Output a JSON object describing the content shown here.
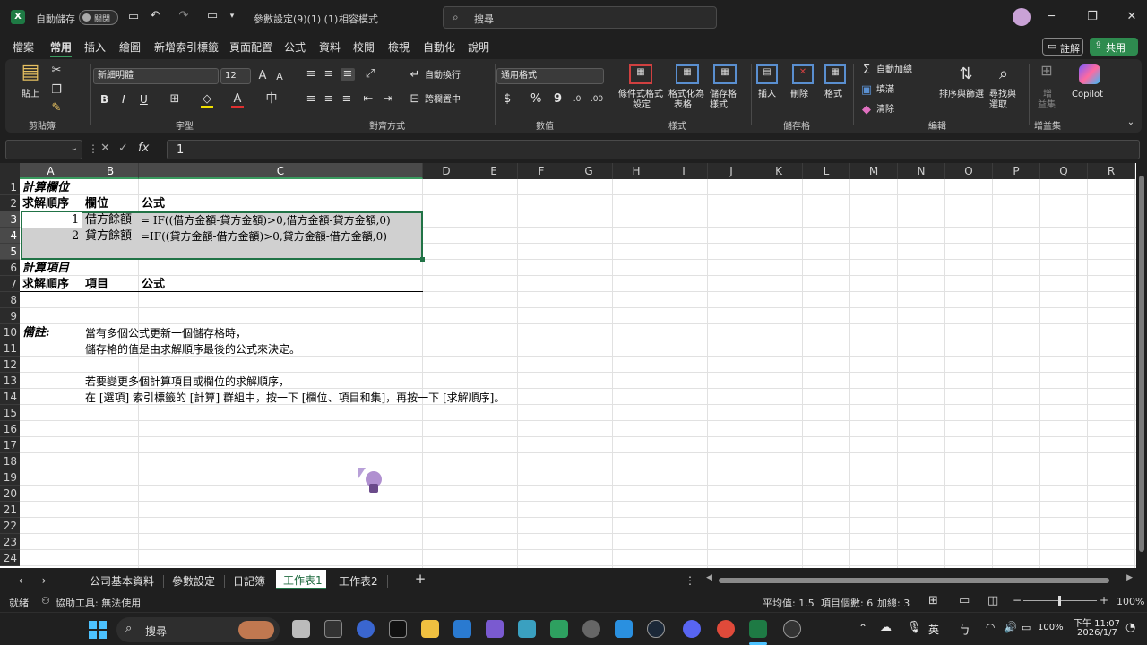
{
  "title_bar": {
    "autosave_label": "自動儲存",
    "autosave_state": "關閉",
    "doc_title": "參數設定(9)(1) (1)",
    "compat_mode": "相容模式",
    "search_placeholder": "搜尋"
  },
  "ribbon_tabs": [
    "檔案",
    "常用",
    "插入",
    "繪圖",
    "新增索引標籤",
    "頁面配置",
    "公式",
    "資料",
    "校閱",
    "檢視",
    "自動化",
    "說明"
  ],
  "ribbon_right": {
    "comments": "註解",
    "share": "共用"
  },
  "ribbon": {
    "clipboard": {
      "paste": "貼上",
      "label": "剪貼簿"
    },
    "font": {
      "name": "新細明體",
      "size": "12",
      "bold": "B",
      "italic": "I",
      "underline": "U",
      "label": "字型"
    },
    "alignment": {
      "wrap": "自動換行",
      "merge": "跨欄置中",
      "label": "對齊方式"
    },
    "number": {
      "format": "通用格式",
      "currency": "$",
      "percent": "%",
      "comma": "9",
      "label": "數值"
    },
    "styles": {
      "cond_format_1": "條件式格式",
      "cond_format_2": "設定",
      "table_1": "格式化為",
      "table_2": "表格",
      "cell_1": "儲存格",
      "cell_2": "樣式",
      "label": "樣式"
    },
    "cells": {
      "insert": "插入",
      "delete": "刪除",
      "format": "格式",
      "label": "儲存格"
    },
    "editing": {
      "autosum": "自動加總",
      "fill": "填滿",
      "clear": "清除",
      "sort_1": "排序與篩選",
      "find_1": "尋找與",
      "find_2": "選取",
      "label": "編輯"
    },
    "addins": {
      "addins_1": "增",
      "addins_2": "益集",
      "copilot": "Copilot",
      "label": "增益集"
    }
  },
  "formula_bar": {
    "fx": "fx",
    "value": "1"
  },
  "columns": [
    "A",
    "B",
    "C",
    "D",
    "E",
    "F",
    "G",
    "H",
    "I",
    "J",
    "K",
    "L",
    "M",
    "N",
    "O",
    "P",
    "Q",
    "R"
  ],
  "rows": [
    "1",
    "2",
    "3",
    "4",
    "5",
    "6",
    "7",
    "8",
    "9",
    "10",
    "11",
    "12",
    "13",
    "14",
    "15",
    "16",
    "17",
    "18",
    "19",
    "20",
    "21",
    "22",
    "23",
    "24"
  ],
  "cells": {
    "r1_a": "計算欄位",
    "r2_a": "求解順序",
    "r2_b": "欄位",
    "r2_c": "公式",
    "r3_a": "1",
    "r3_b": "借方餘額",
    "r3_c": "= IF((借方金額-貸方金額)>0,借方金額-貸方金額,0)",
    "r4_a": "2",
    "r4_b": "貸方餘額",
    "r4_c": "=IF((貸方金額-借方金額)>0,貸方金額-借方金額,0)",
    "r6_a": "計算項目",
    "r7_a": "求解順序",
    "r7_b": "項目",
    "r7_c": "公式",
    "r10_a": "備註:",
    "r10_b": "當有多個公式更新一個儲存格時，",
    "r11_b": "儲存格的值是由求解順序最後的公式來決定。",
    "r13_b": "若要變更多個計算項目或欄位的求解順序，",
    "r14_b": "在 [選項] 索引標籤的 [計算] 群組中，按一下 [欄位、項目和集]，再按一下 [求解順序]。"
  },
  "sheet_tabs": [
    "公司基本資料",
    "參數設定",
    "日記簿",
    "工作表1",
    "工作表2"
  ],
  "active_sheet": "工作表1",
  "status": {
    "ready": "就緒",
    "accessibility": "協助工具: 無法使用",
    "average": "平均值: 1.5",
    "count": "項目個數: 6",
    "sum": "加總: 3",
    "zoom": "100%"
  },
  "taskbar": {
    "search": "搜尋",
    "ime": "英",
    "battery": "100%",
    "time": "下午 11:07",
    "date": "2026/1/7"
  },
  "colors": {
    "accent": "#3a9b5f",
    "share_btn": "#2e8b4f",
    "selection": "#d0d0d0"
  }
}
